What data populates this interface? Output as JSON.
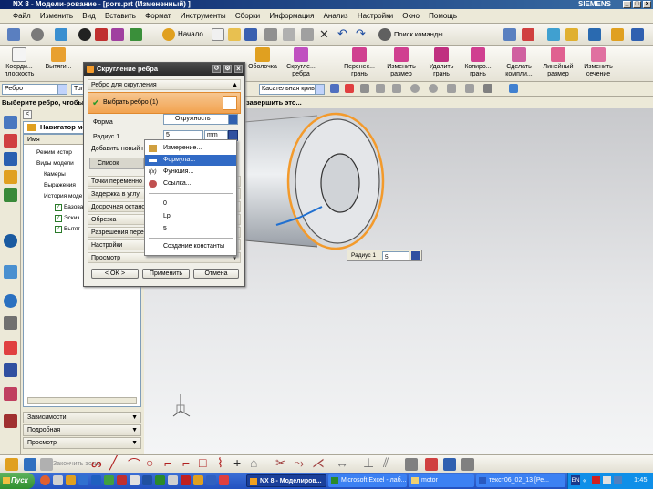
{
  "window": {
    "title": "NX 8 - Модели-рование - [pors.prt (Измененный) ]",
    "brand": "SIEMENS"
  },
  "menu": [
    "Файл",
    "Изменить",
    "Вид",
    "Вставить",
    "Формат",
    "Инструменты",
    "Сборки",
    "Информация",
    "Анализ",
    "Настройки",
    "Окно",
    "Помощь"
  ],
  "toolbar": {
    "start_label": "Начало",
    "find_command": "Поиск команды"
  },
  "ribbon": {
    "left": [
      {
        "label": "Коорди... плоскость"
      },
      {
        "label": "Вытяги..."
      }
    ],
    "right": [
      {
        "label": "Оболочка"
      },
      {
        "label": "Скругле... ребра"
      },
      {
        "label": "Перенес... грань"
      },
      {
        "label": "Изменить размер"
      },
      {
        "label": "Удалить грань"
      },
      {
        "label": "Копиро... грань"
      },
      {
        "label": "Сделать компли..."
      },
      {
        "label": "Линейный размер"
      },
      {
        "label": "Изменить сечение"
      }
    ]
  },
  "filterbar": {
    "filter1": "Ребро",
    "filter2": "Тол",
    "rule": "Касательная кривая"
  },
  "status": {
    "left": "Выберите ребро, чтобы",
    "right": "завершить это..."
  },
  "navigator": {
    "title": "Навигатор мо",
    "column": "Имя",
    "rows": [
      "Режим истор",
      "Виды модели",
      "Камеры",
      "Выражения",
      "История моде",
      "Базова",
      "Эскиз",
      "Вытяг"
    ],
    "sections": [
      "Зависимости",
      "Подробная",
      "Просмотр"
    ]
  },
  "dialog": {
    "title": "Скругление ребра",
    "section1": "Ребро для скругления",
    "select_label": "Выбрать ребро (1)",
    "shape_label": "Форма",
    "shape_value": "Окружность",
    "radius_label": "Радиус 1",
    "radius_value": "5",
    "radius_unit": "mm",
    "add_new": "Добавить новый н",
    "list_label": "Список",
    "sections": [
      "Точки переменно",
      "Задержка в углу",
      "Досрочная останов",
      "Обрезка",
      "Разрешения перекр",
      "Настройки",
      "Просмотр"
    ],
    "ok": "< OK >",
    "apply": "Применить",
    "cancel": "Отмена"
  },
  "dropdown": {
    "items": [
      "Измерение...",
      "Формула...",
      "Функция...",
      "Ссылка...",
      "0",
      "Lp",
      "5",
      "Создание константы"
    ],
    "selected": "Формула..."
  },
  "radius_popup": {
    "label": "Радиус 1",
    "value": "5"
  },
  "bottombar": {
    "finish_sketch": "Закончить эскиз"
  },
  "taskbar": {
    "start": "Пуск",
    "tasks": [
      "NX 8 - Моделиров...",
      "Microsoft Excel - лаб...",
      "motor",
      "текст06_02_13 [Ре..."
    ],
    "lang": "EN",
    "clock": "1:45"
  },
  "colors": {
    "accent_orange": "#f39a2b",
    "selected_blue": "#316ac5",
    "title_dark": "#2a2a2a"
  }
}
